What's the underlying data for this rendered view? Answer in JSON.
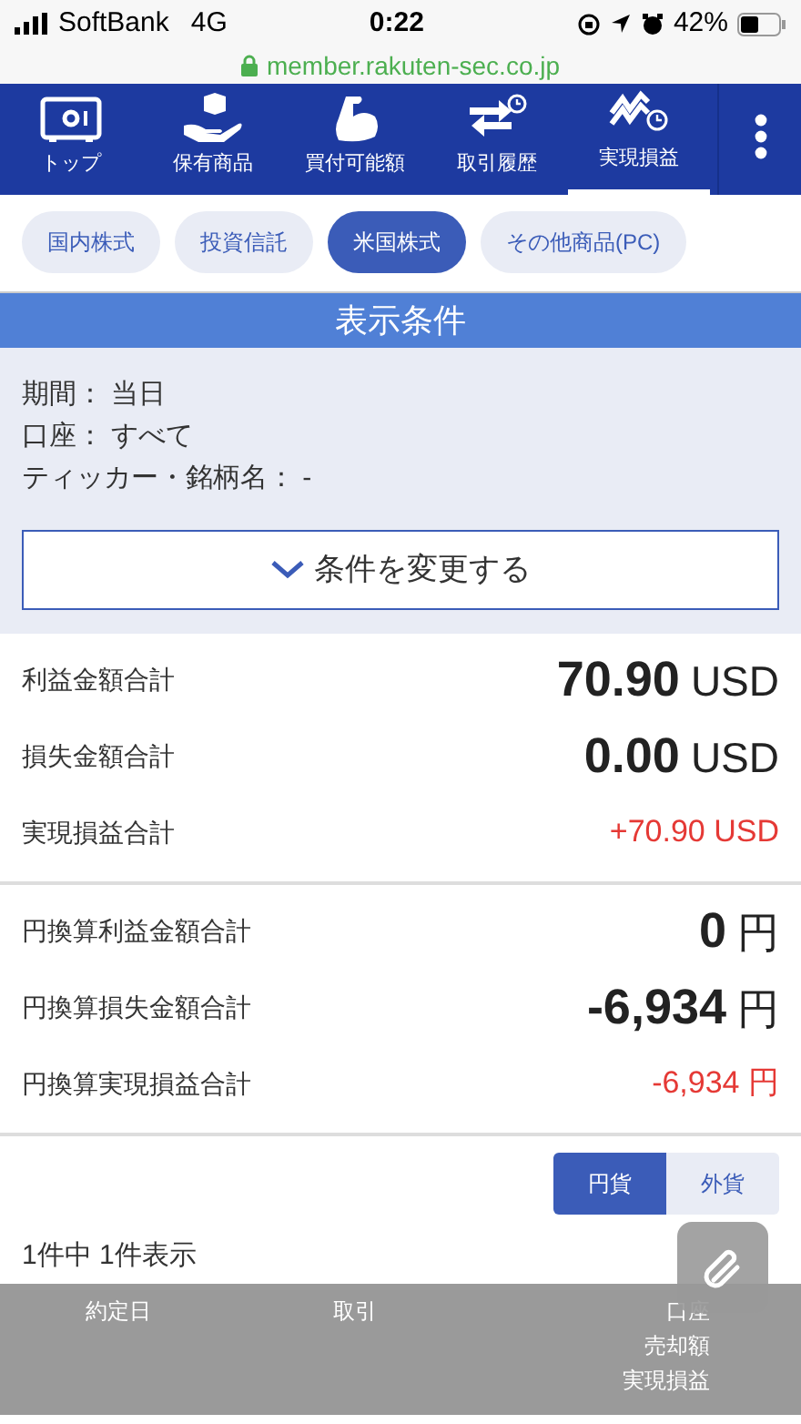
{
  "status_bar": {
    "carrier": "SoftBank",
    "network": "4G",
    "time": "0:22",
    "battery": "42%"
  },
  "address_bar": {
    "url": "member.rakuten-sec.co.jp"
  },
  "nav": [
    {
      "label": "トップ",
      "kind": "safe",
      "selected": false
    },
    {
      "label": "保有商品",
      "kind": "box",
      "selected": false
    },
    {
      "label": "買付可能額",
      "kind": "arm",
      "selected": false
    },
    {
      "label": "取引履歴",
      "kind": "swap",
      "selected": false
    },
    {
      "label": "実現損益",
      "kind": "trend",
      "selected": true
    }
  ],
  "tabs": [
    {
      "label": "国内株式",
      "selected": false
    },
    {
      "label": "投資信託",
      "selected": false
    },
    {
      "label": "米国株式",
      "selected": true
    },
    {
      "label": "その他商品(PC)",
      "selected": false
    }
  ],
  "conditions": {
    "title": "表示条件",
    "items": [
      "期間： 当日",
      "口座： すべて",
      "ティッカー・銘柄名： -"
    ],
    "button": "条件を変更する"
  },
  "totals": [
    {
      "label": "利益金額合計",
      "value": "70.90",
      "unit": "USD",
      "kind": "big"
    },
    {
      "label": "損失金額合計",
      "value": "0.00",
      "unit": "USD",
      "kind": "big"
    },
    {
      "label": "実現損益合計",
      "value": "+70.90 USD",
      "kind": "red"
    }
  ],
  "yen_totals": [
    {
      "label": "円換算利益金額合計",
      "value": "0",
      "unit": "円",
      "kind": "big"
    },
    {
      "label": "円換算損失金額合計",
      "value": "-6,934",
      "unit": "円",
      "kind": "big"
    },
    {
      "label": "円換算実現損益合計",
      "value": "-6,934 円",
      "kind": "red"
    }
  ],
  "currency_toggle": [
    {
      "label": "円貨",
      "selected": true
    },
    {
      "label": "外貨",
      "selected": false
    }
  ],
  "count": "1件中 1件表示",
  "table": {
    "columns": [
      "約定日",
      "取引",
      "口座"
    ],
    "column_3_sub": [
      "売却額",
      "実現損益"
    ]
  }
}
